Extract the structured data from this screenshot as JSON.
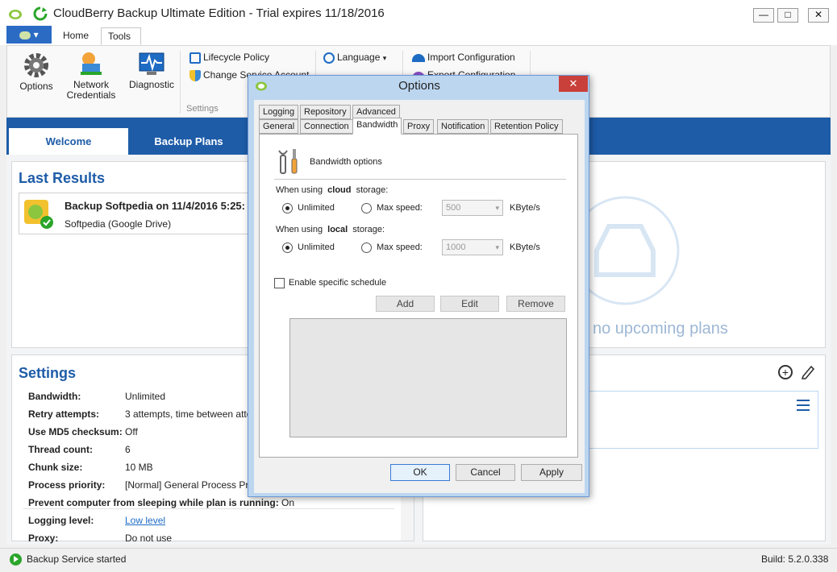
{
  "window": {
    "title": "CloudBerry Backup Ultimate Edition - Trial expires 11/18/2016",
    "controls": {
      "minimize": "—",
      "maximize": "□",
      "close": "✕"
    }
  },
  "ribbon": {
    "app_menu_label": "▾",
    "tabs": [
      {
        "label": "Home"
      },
      {
        "label": "Tools"
      }
    ],
    "buttons": {
      "options": "Options",
      "network_credentials_1": "Network",
      "network_credentials_2": "Credentials",
      "diagnostic": "Diagnostic",
      "lifecycle_policy": "Lifecycle Policy",
      "change_service_account": "Change Service Account",
      "language": "Language",
      "import_configuration": "Import Configuration",
      "export_configuration": "Export Configuration"
    },
    "group_label": "Settings"
  },
  "main_tabs": [
    {
      "label": "Welcome"
    },
    {
      "label": "Backup Plans"
    }
  ],
  "last_results": {
    "heading": "Last Results",
    "item_title": "Backup Softpedia on 11/4/2016 5:25:",
    "item_subtitle": "Softpedia (Google Drive)"
  },
  "upcoming": {
    "text": "no upcoming plans"
  },
  "settings": {
    "heading": "Settings",
    "rows": [
      {
        "key": "Bandwidth:",
        "value": "Unlimited"
      },
      {
        "key": "Retry attempts:",
        "value": "3  attempts, time between atte"
      },
      {
        "key": "Use MD5 checksum:",
        "value": "Off"
      },
      {
        "key": "Thread count:",
        "value": "6"
      },
      {
        "key": "Chunk size:",
        "value": "10 MB"
      },
      {
        "key": "Process priority:",
        "value": "[Normal] General Process Prio"
      },
      {
        "key": "Prevent computer from sleeping while plan is running:",
        "value": "On"
      },
      {
        "key": "Logging level:",
        "value": "Low level"
      },
      {
        "key": "Proxy:",
        "value": "Do not use"
      }
    ]
  },
  "status": {
    "message": "Backup Service started",
    "build": "Build:  5.2.0.338"
  },
  "dialog": {
    "title": "Options",
    "close": "✕",
    "tabs_row1": [
      {
        "label": "Logging"
      },
      {
        "label": "Repository"
      },
      {
        "label": "Advanced"
      }
    ],
    "tabs_row2": [
      {
        "label": "General"
      },
      {
        "label": "Connection"
      },
      {
        "label": "Bandwidth"
      },
      {
        "label": "Proxy"
      },
      {
        "label": "Notification"
      },
      {
        "label": "Retention Policy"
      }
    ],
    "section_title": "Bandwidth options",
    "cloud_label_prefix": "When using",
    "cloud_label_bold": "cloud",
    "cloud_label_suffix": "storage:",
    "local_label_prefix": "When using",
    "local_label_bold": "local",
    "local_label_suffix": "storage:",
    "unlimited": "Unlimited",
    "max_speed": "Max speed:",
    "cloud_speed_value": "500",
    "local_speed_value": "1000",
    "unit": "KByte/s",
    "cloud_mode": "Unlimited",
    "local_mode": "Unlimited",
    "schedule_checkbox": "Enable specific schedule",
    "schedule_enabled": false,
    "add": "Add",
    "edit": "Edit",
    "remove": "Remove",
    "ok": "OK",
    "cancel": "Cancel",
    "apply": "Apply"
  },
  "colors": {
    "accent": "#1e5ca8",
    "close_red": "#c9403a",
    "dialog_frame": "#bcd6f0",
    "status_green": "#2aa52a"
  }
}
